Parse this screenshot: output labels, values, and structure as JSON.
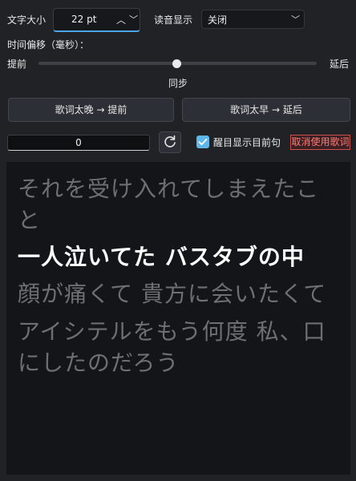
{
  "font_size": {
    "label": "文字大小",
    "value": "22 pt"
  },
  "reading_display": {
    "label": "读音显示",
    "value": "关闭"
  },
  "time_offset": {
    "label": "时间偏移（毫秒）：",
    "left_label": "提前",
    "right_label": "延后",
    "center_label": "同步",
    "position": 0.5
  },
  "buttons": {
    "lyrics_late": "歌词太晚 → 提前",
    "lyrics_early": "歌词太早 → 延后"
  },
  "offset_value": "0",
  "reset_icon": "refresh-icon",
  "highlight_checkbox": {
    "label": "醒目显示目前句",
    "checked": true
  },
  "cancel_label": "取消使用歌词",
  "lyrics": [
    {
      "text": "それを受け入れてしまえたこ",
      "active": false
    },
    {
      "text": "と",
      "active": false
    },
    {
      "text": "一人泣いてた バスタブの中",
      "active": true
    },
    {
      "text": "顔が痛くて 貴方に会いたくて",
      "active": false
    },
    {
      "text": "アイシテルをもう何度 私、口",
      "active": false
    },
    {
      "text": "にしたのだろう",
      "active": false
    }
  ],
  "colors": {
    "background": "#202226",
    "accent": "#4aa6e8",
    "checkbox": "#5eb6ea",
    "cancel": "#ff7d78",
    "lyric_active": "#ffffff",
    "lyric_inactive": "#6d6f74"
  }
}
